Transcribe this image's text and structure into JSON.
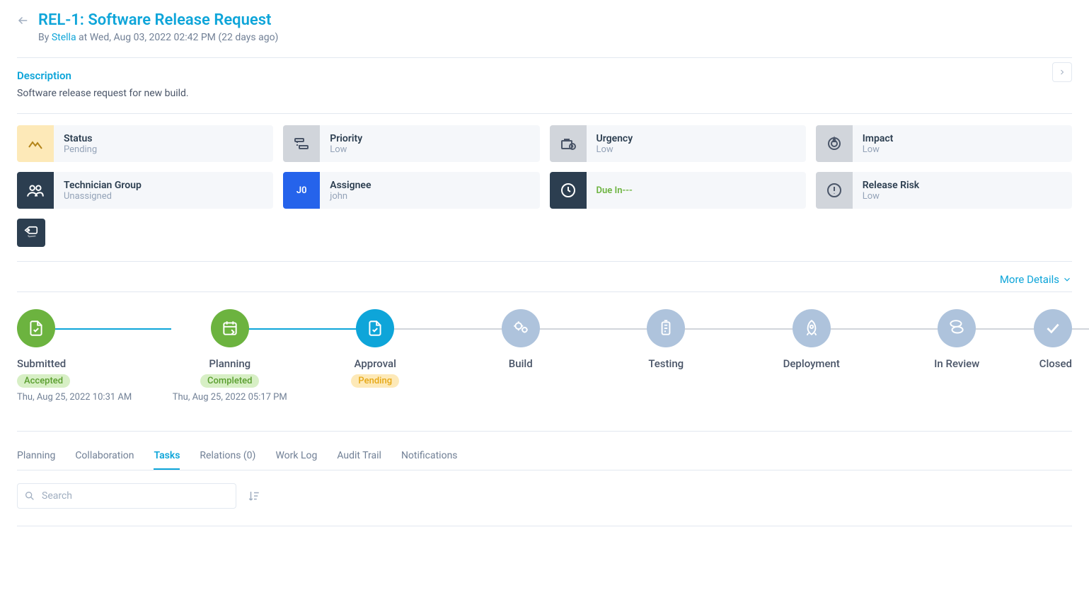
{
  "header": {
    "title": "REL-1: Software Release Request",
    "byline_prefix": "By ",
    "author": "Stella",
    "byline_suffix": " at Wed, Aug 03, 2022 02:42 PM (22 days ago)"
  },
  "description": {
    "label": "Description",
    "text": "Software release request for new build."
  },
  "info_cards": {
    "status": {
      "label": "Status",
      "value": "Pending"
    },
    "priority": {
      "label": "Priority",
      "value": "Low"
    },
    "urgency": {
      "label": "Urgency",
      "value": "Low"
    },
    "impact": {
      "label": "Impact",
      "value": "Low"
    },
    "tech_group": {
      "label": "Technician Group",
      "value": "Unassigned"
    },
    "assignee": {
      "label": "Assignee",
      "value": "john",
      "avatar": "J0"
    },
    "due_in": {
      "label": "Due In---"
    },
    "release_risk": {
      "label": "Release Risk",
      "value": "Low"
    }
  },
  "more_details": "More Details",
  "stages": [
    {
      "name": "Submitted",
      "status": "Accepted",
      "badge": "accepted",
      "date": "Thu, Aug 25, 2022 10:31 AM",
      "state": "done"
    },
    {
      "name": "Planning",
      "status": "Completed",
      "badge": "completed",
      "date": "Thu, Aug 25, 2022 05:17 PM",
      "state": "done"
    },
    {
      "name": "Approval",
      "status": "Pending",
      "badge": "pending",
      "state": "current"
    },
    {
      "name": "Build",
      "state": "future"
    },
    {
      "name": "Testing",
      "state": "future"
    },
    {
      "name": "Deployment",
      "state": "future"
    },
    {
      "name": "In Review",
      "state": "future"
    },
    {
      "name": "Closed",
      "state": "future"
    }
  ],
  "tabs": [
    {
      "label": "Planning",
      "active": false
    },
    {
      "label": "Collaboration",
      "active": false
    },
    {
      "label": "Tasks",
      "active": true
    },
    {
      "label": "Relations (0)",
      "active": false
    },
    {
      "label": "Work Log",
      "active": false
    },
    {
      "label": "Audit Trail",
      "active": false
    },
    {
      "label": "Notifications",
      "active": false
    }
  ],
  "search": {
    "placeholder": "Search"
  }
}
